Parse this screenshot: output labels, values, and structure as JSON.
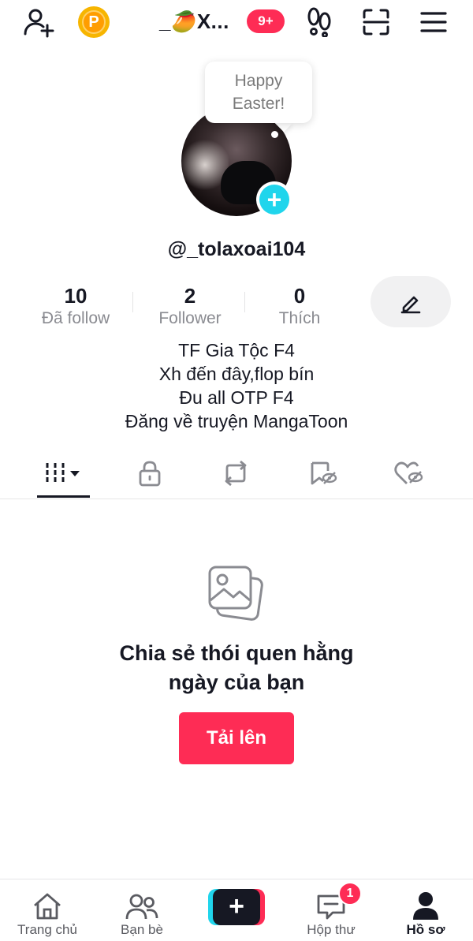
{
  "header": {
    "account_name": "_🥭X...",
    "notification_badge": "9+",
    "coin_letter": "P",
    "icons": [
      "add-friend-icon",
      "coin-icon",
      "footprints-icon",
      "scan-icon",
      "menu-icon"
    ]
  },
  "profile": {
    "bubble_text_line1": "Happy",
    "bubble_text_line2": "Easter!",
    "username": "@_tolaxoai104",
    "stats": [
      {
        "value": "10",
        "label": "Đã follow"
      },
      {
        "value": "2",
        "label": "Follower"
      },
      {
        "value": "0",
        "label": "Thích"
      }
    ],
    "bio": [
      "TF Gia Tộc F4",
      "Xh đến đây,flop bín",
      "Đu all OTP F4",
      "Đăng về truyện MangaToon"
    ]
  },
  "tabs": [
    "videos-grid-icon",
    "lock-icon",
    "repost-icon",
    "favorites-icon",
    "liked-icon"
  ],
  "empty_state": {
    "title_line1": "Chia sẻ thói quen hằng",
    "title_line2": "ngày của bạn",
    "button_label": "Tải lên"
  },
  "bottom_nav": {
    "items": [
      {
        "label": "Trang chủ"
      },
      {
        "label": "Bạn bè"
      },
      {
        "label": ""
      },
      {
        "label": "Hộp thư"
      },
      {
        "label": "Hồ sơ"
      }
    ],
    "inbox_badge": "1",
    "create_symbol": "+"
  },
  "colors": {
    "accent": "#fe2c55",
    "cyan": "#20d5ec",
    "text": "#161823",
    "muted": "#8a8b91"
  }
}
